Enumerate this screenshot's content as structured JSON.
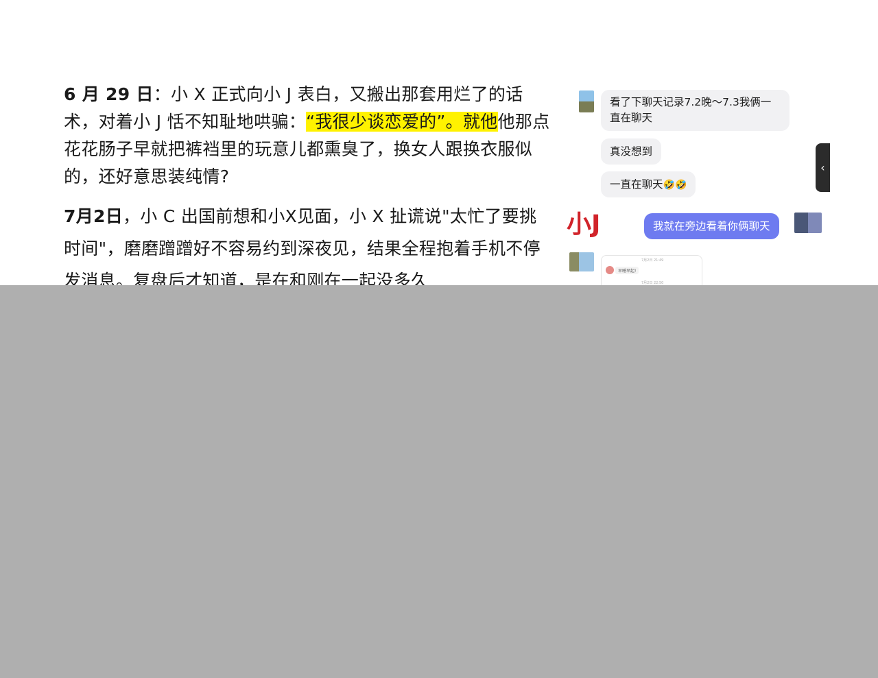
{
  "article": {
    "p1": {
      "date": "6 月 29 日",
      "before_highlight": "：小 X 正式向小 J 表白，又搬出那套用烂了的话术，对着小 J 恬不知耻地哄骗：",
      "highlight": "“我很少谈恋爱的”。就他",
      "after_highlight": "他那点花花肠子早就把裤裆里的玩意儿都熏臭了，换女人跟换衣服似的，还好意思装纯情?"
    },
    "p2": {
      "date": "7月2日",
      "text": "，小 C 出国前想和小X见面，小 X 扯谎说\"太忙了要挑时间\"，磨磨蹭蹭好不容易约到深夜见，结果全程抱着手机不停发消息。复盘后才知道，是在和刚在一起没多久"
    }
  },
  "chat": {
    "messages": [
      {
        "text": "看了下聊天记录7.2晚～7.3我俩一直在聊天"
      },
      {
        "text": "真没想到"
      },
      {
        "text": "一直在聊天",
        "emoji": "🤣🤣"
      },
      {
        "text": "我就在旁边看着你俩聊天"
      }
    ],
    "name_label": "小J",
    "mini_card": {
      "time_1": "7月2日 21:49",
      "bubble": "早睡早起!",
      "time_2": "7月2日 22:50"
    },
    "collapse_icon": "‹"
  },
  "colors": {
    "highlight": "#fff200",
    "name_label": "#d1232a",
    "self_bubble": "#6e7bf0",
    "overlay": "#afafaf"
  }
}
